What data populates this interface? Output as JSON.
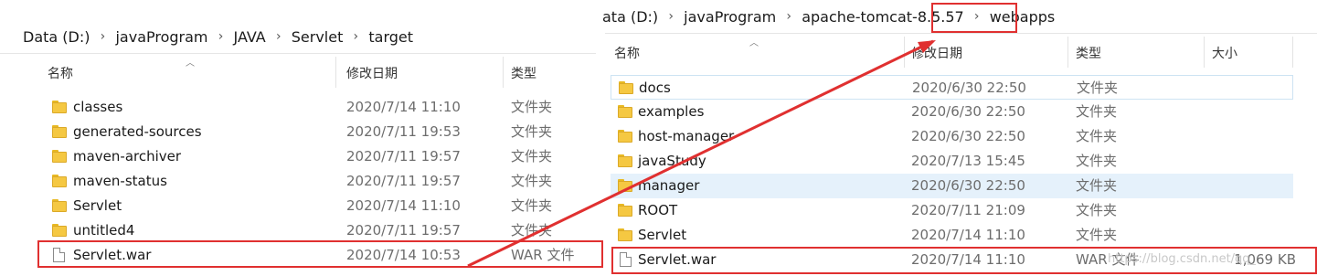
{
  "left": {
    "breadcrumb": [
      "Data (D:)",
      "javaProgram",
      "JAVA",
      "Servlet",
      "target"
    ],
    "columns": {
      "name": "名称",
      "date": "修改日期",
      "type": "类型"
    },
    "rows": [
      {
        "icon": "folder-icon",
        "name": "classes",
        "date": "2020/7/14 11:10",
        "type": "文件夹"
      },
      {
        "icon": "folder-icon",
        "name": "generated-sources",
        "date": "2020/7/11 19:53",
        "type": "文件夹"
      },
      {
        "icon": "folder-icon",
        "name": "maven-archiver",
        "date": "2020/7/11 19:57",
        "type": "文件夹"
      },
      {
        "icon": "folder-icon",
        "name": "maven-status",
        "date": "2020/7/11 19:57",
        "type": "文件夹"
      },
      {
        "icon": "folder-icon",
        "name": "Servlet",
        "date": "2020/7/14 11:10",
        "type": "文件夹"
      },
      {
        "icon": "folder-icon",
        "name": "untitled4",
        "date": "2020/7/11 19:57",
        "type": "文件夹"
      },
      {
        "icon": "file-icon",
        "name": "Servlet.war",
        "date": "2020/7/14 10:53",
        "type": "WAR 文件"
      }
    ]
  },
  "right": {
    "breadcrumb": [
      "ata (D:)",
      "javaProgram",
      "apache-tomcat-8.5.57",
      "webapps"
    ],
    "columns": {
      "name": "名称",
      "date": "修改日期",
      "type": "类型",
      "size": "大小"
    },
    "rows": [
      {
        "icon": "folder-icon",
        "name": "docs",
        "date": "2020/6/30 22:50",
        "type": "文件夹",
        "size": ""
      },
      {
        "icon": "folder-icon",
        "name": "examples",
        "date": "2020/6/30 22:50",
        "type": "文件夹",
        "size": ""
      },
      {
        "icon": "folder-icon",
        "name": "host-manager",
        "date": "2020/6/30 22:50",
        "type": "文件夹",
        "size": ""
      },
      {
        "icon": "folder-icon",
        "name": "javaStudy",
        "date": "2020/7/13 15:45",
        "type": "文件夹",
        "size": ""
      },
      {
        "icon": "folder-icon",
        "name": "manager",
        "date": "2020/6/30 22:50",
        "type": "文件夹",
        "size": ""
      },
      {
        "icon": "folder-icon",
        "name": "ROOT",
        "date": "2020/7/11 21:09",
        "type": "文件夹",
        "size": ""
      },
      {
        "icon": "folder-icon",
        "name": "Servlet",
        "date": "2020/7/14 11:10",
        "type": "文件夹",
        "size": ""
      },
      {
        "icon": "file-icon",
        "name": "Servlet.war",
        "date": "2020/7/14 11:10",
        "type": "WAR 文件",
        "size": "1,069 KB"
      }
    ]
  },
  "watermark": "https://blog.csdn.net/qq_",
  "annotation_color": "#e03030"
}
